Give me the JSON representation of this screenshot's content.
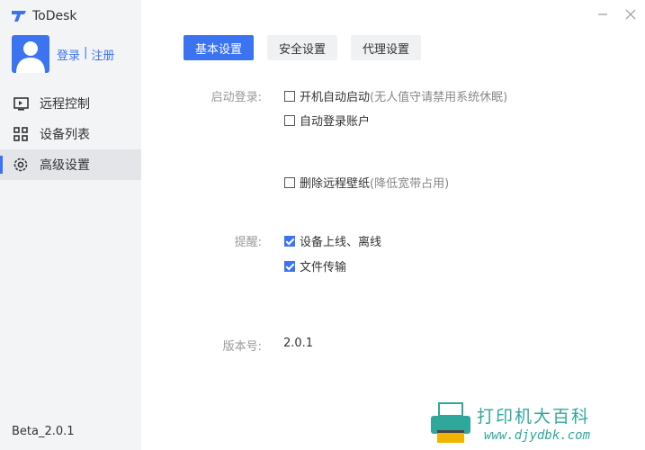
{
  "app": {
    "name": "ToDesk"
  },
  "sidebar": {
    "login_label": "登录",
    "separator": "|",
    "register_label": "注册",
    "items": [
      {
        "label": "远程控制",
        "icon": "monitor-icon"
      },
      {
        "label": "设备列表",
        "icon": "grid-icon"
      },
      {
        "label": "高级设置",
        "icon": "gear-icon",
        "active": true
      }
    ],
    "version": "Beta_2.0.1"
  },
  "tabs": [
    {
      "label": "基本设置",
      "active": true
    },
    {
      "label": "安全设置",
      "active": false
    },
    {
      "label": "代理设置",
      "active": false
    }
  ],
  "settings": {
    "startup_label": "启动登录:",
    "auto_start": {
      "label": "开机自动启动",
      "hint": "(无人值守请禁用系统休眠)",
      "checked": false
    },
    "auto_login": {
      "label": "自动登录账户",
      "checked": false
    },
    "remove_wallpaper": {
      "label": "删除远程壁纸",
      "hint": "(降低宽带占用)",
      "checked": false
    },
    "remind_label": "提醒:",
    "device_online": {
      "label": "设备上线、离线",
      "checked": true
    },
    "file_transfer": {
      "label": "文件传输",
      "checked": true
    },
    "version_label": "版本号:",
    "version_value": "2.0.1"
  },
  "watermark": {
    "text": "打印机大百科",
    "url": "www.djydbk.com"
  },
  "colors": {
    "accent": "#3c73f0",
    "sidebar_bg": "#f3f4f6",
    "watermark": "#2fa89b"
  }
}
